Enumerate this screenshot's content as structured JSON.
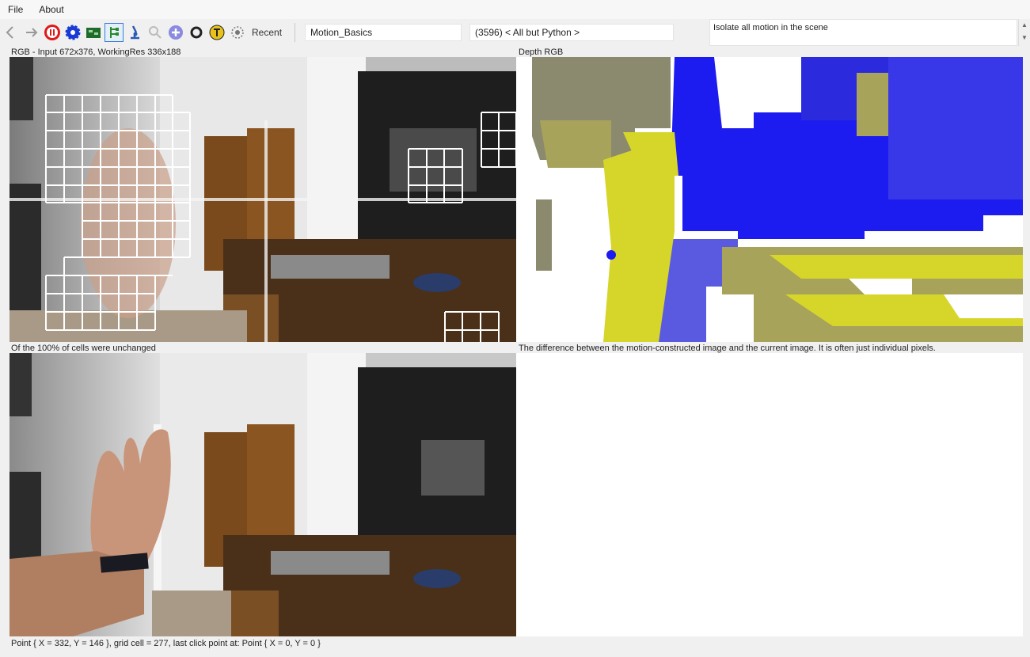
{
  "menu": {
    "file": "File",
    "about": "About"
  },
  "toolbar": {
    "recent_label": "Recent",
    "algorithm": "Motion_Basics",
    "group": "(3596) < All but Python >",
    "description": "Isolate all motion in the scene",
    "icons": [
      "back-arrow-icon",
      "forward-arrow-icon",
      "pause-icon",
      "gear-icon",
      "board-icon",
      "tree-icon",
      "microscope-icon",
      "magnifier-icon",
      "plus-icon",
      "o-icon",
      "pin-icon",
      "spider-icon"
    ]
  },
  "panels": {
    "top_left": {
      "title": "RGB - Input 672x376, WorkingRes 336x188",
      "caption": "Of the 100% of cells were unchanged"
    },
    "top_right": {
      "title": "Depth RGB",
      "caption": "The difference between the motion-constructed image and the current image.  It is often just individual pixels."
    },
    "status": "Point { X = 332, Y = 146 }, grid cell = 277, last click point at: Point { X = 0, Y = 0 }"
  },
  "colors": {
    "depth_blue": "#1c1cf0",
    "depth_yellow": "#d6d62a",
    "depth_olive": "#a8a35a",
    "grid_line": "#ffffff"
  }
}
